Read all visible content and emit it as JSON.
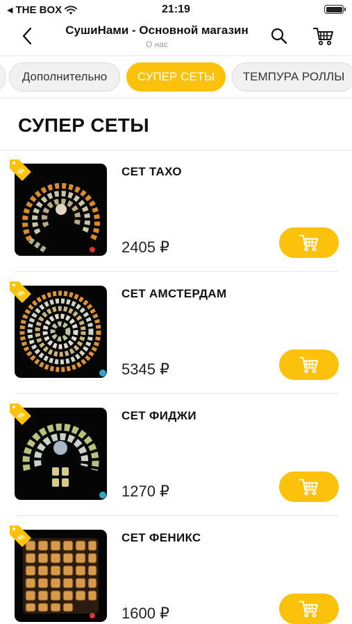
{
  "status_bar": {
    "carrier": "THE BOX",
    "time": "21:19",
    "icons": [
      "back-to-app-icon",
      "wifi-icon",
      "battery-icon"
    ]
  },
  "nav": {
    "title": "СушиНами - Основной магазин",
    "subtitle": "О нас",
    "icons": [
      "chevron-left-icon",
      "search-icon",
      "cart-icon"
    ]
  },
  "tabs": [
    {
      "label": "Дополнительно",
      "active": false
    },
    {
      "label": "СУПЕР СЕТЫ",
      "active": true
    },
    {
      "label": "ТЕМПУРА РОЛЛЫ",
      "active": false
    }
  ],
  "section": {
    "title": "СУПЕР СЕТЫ"
  },
  "products": [
    {
      "name": "СЕТ ТАХО",
      "price": "2405 ₽"
    },
    {
      "name": "СЕТ АМСТЕРДАМ",
      "price": "5345 ₽"
    },
    {
      "name": "СЕТ ФИДЖИ",
      "price": "1270 ₽"
    },
    {
      "name": "СЕТ ФЕНИКС",
      "price": "1600 ₽"
    }
  ],
  "colors": {
    "accent": "#fcc10a",
    "tab_inactive_bg": "#f1f1f1",
    "divider": "#e6e6e6",
    "subtitle": "#9a9a9a"
  }
}
